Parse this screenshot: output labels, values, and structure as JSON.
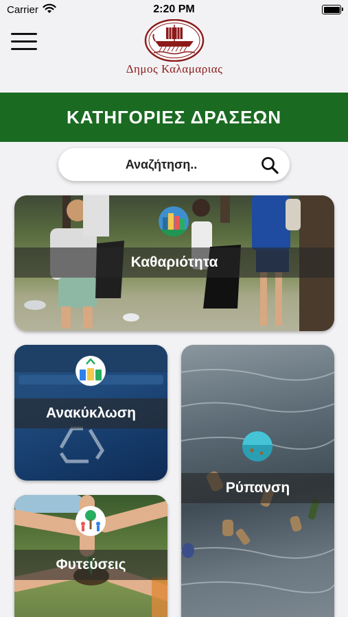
{
  "status_bar": {
    "carrier": "Carrier",
    "time": "2:20 PM",
    "icons": [
      "wifi-icon",
      "battery-icon"
    ]
  },
  "header": {
    "logo_text": "Δημος Καλαμαριας",
    "menu_icon": "hamburger-menu-icon"
  },
  "banner": {
    "title": "ΚΑΤΗΓΟΡΙΕΣ ΔΡΑΣΕΩΝ"
  },
  "search": {
    "placeholder": "Αναζήτηση..",
    "icon": "search-icon"
  },
  "categories": [
    {
      "label": "Καθαριότητα",
      "icon": "city-cleaning-badge-icon"
    },
    {
      "label": "Ανακύκλωση",
      "icon": "recycling-bins-badge-icon"
    },
    {
      "label": "Ρύπανση",
      "icon": "polluted-water-badge-icon"
    },
    {
      "label": "Φυτεύσεις",
      "icon": "tree-planting-badge-icon"
    }
  ],
  "colors": {
    "banner_green": "#1b6a22",
    "logo_red": "#8c1a1a",
    "background": "#f2f2f4"
  }
}
